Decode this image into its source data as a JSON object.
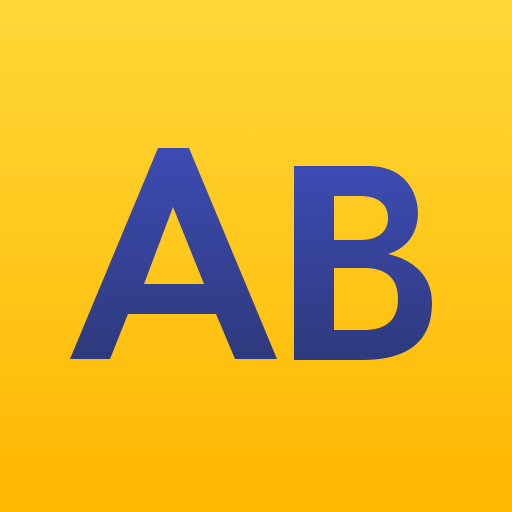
{
  "app_icon": {
    "monogram": "AB",
    "colors": {
      "background_top": "#FFD837",
      "background_bottom": "#FFB700",
      "letter_top": "#3D4BB4",
      "letter_bottom": "#2E3A7C"
    }
  }
}
